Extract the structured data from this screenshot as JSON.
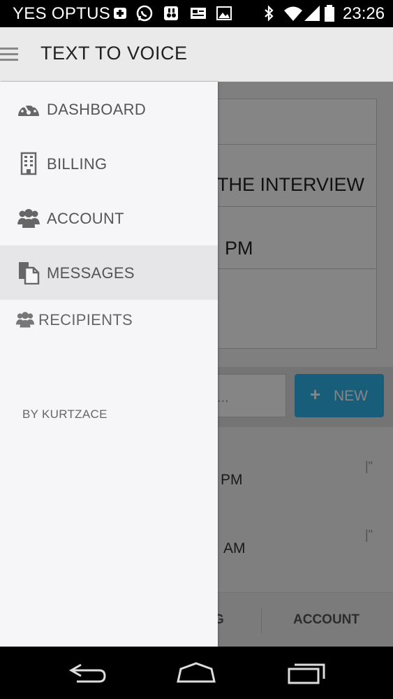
{
  "status_bar": {
    "carrier": "YES OPTUS",
    "time": "23:26",
    "icons": [
      "plus-notification-icon",
      "whatsapp-icon",
      "voicemail-icon",
      "sim-card-icon",
      "image-icon",
      "bluetooth-icon",
      "wifi-icon",
      "signal-icon",
      "battery-icon"
    ]
  },
  "app_bar": {
    "title": "TEXT TO VOICE",
    "menu_icon": "hamburger-menu-icon"
  },
  "drawer": {
    "items": [
      {
        "label": "DASHBOARD",
        "icon": "dashboard-gauge-icon",
        "active": false
      },
      {
        "label": "BILLING",
        "icon": "building-icon",
        "active": false
      },
      {
        "label": "ACCOUNT",
        "icon": "users-icon",
        "active": false
      },
      {
        "label": "MESSAGES",
        "icon": "documents-icon",
        "active": true
      }
    ],
    "recipients": {
      "label": "RECIPIENTS",
      "icon": "users-icon"
    },
    "byline": "BY KURTZACE"
  },
  "background": {
    "card_rows": [
      "THE INTERVIEW",
      "PM"
    ],
    "search_placeholder": "s...",
    "new_button": "NEW",
    "list_items": [
      {
        "time": "PM",
        "mark": "|\""
      },
      {
        "time": "AM",
        "mark": "|\""
      }
    ],
    "bottom_tabs": [
      "G",
      "ACCOUNT"
    ]
  },
  "colors": {
    "accent": "#2fb2ea",
    "drawer_bg": "#f6f5f8",
    "drawer_active": "#e6e5e8",
    "app_bar": "#eaeaea"
  },
  "nav_bar": {
    "buttons": [
      "back-icon",
      "home-icon",
      "recent-apps-icon"
    ]
  }
}
